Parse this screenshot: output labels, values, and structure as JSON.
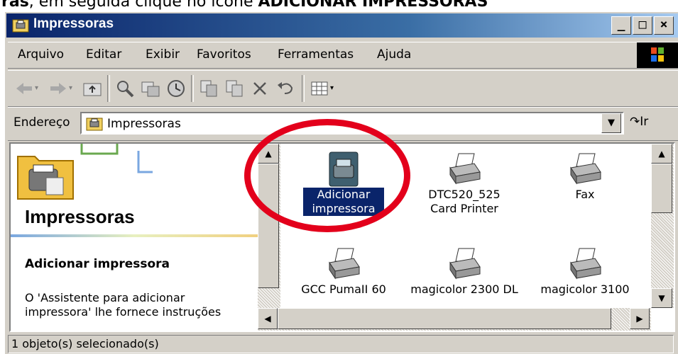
{
  "caption": {
    "prefix": "ras",
    "middle": ", em seguida clique no ícone ",
    "emphasis": "ADICIONAR IMPRESSORAS"
  },
  "window": {
    "title": "Impressoras",
    "controls": {
      "minimize": "_",
      "maximize": "□",
      "close": "×"
    }
  },
  "menubar": {
    "items": [
      {
        "label": "Arquivo"
      },
      {
        "label": "Editar"
      },
      {
        "label": "Exibir"
      },
      {
        "label": "Favoritos"
      },
      {
        "label": "Ferramentas"
      },
      {
        "label": "Ajuda"
      }
    ]
  },
  "toolbar": {
    "icons": [
      "back-icon",
      "forward-icon",
      "up-folder-icon",
      "search-icon",
      "folders-icon",
      "history-icon",
      "move-to-icon",
      "copy-to-icon",
      "delete-icon",
      "undo-icon",
      "views-icon"
    ]
  },
  "address": {
    "label": "Endereço",
    "value": "Impressoras",
    "go_label": "Ir"
  },
  "left_pane": {
    "title": "Impressoras",
    "subtitle": "Adicionar impressora",
    "description": "O 'Assistente para adicionar impressora' lhe fornece instruções"
  },
  "items": [
    {
      "label": "Adicionar impressora",
      "selected": true,
      "icon": "add-printer-icon"
    },
    {
      "label": "DTC520_525 Card Printer",
      "selected": false,
      "icon": "printer-icon"
    },
    {
      "label": "Fax",
      "selected": false,
      "icon": "fax-printer-icon"
    },
    {
      "label": "GCC PumaII 60",
      "selected": false,
      "icon": "printer-icon"
    },
    {
      "label": "magicolor 2300 DL",
      "selected": false,
      "icon": "printer-icon"
    },
    {
      "label": "magicolor 3100",
      "selected": false,
      "icon": "printer-icon"
    }
  ],
  "status": {
    "text": "1 objeto(s) selecionado(s)"
  },
  "colors": {
    "titlebar": "#0a246a",
    "selection": "#0a246a",
    "annotation": "#e3001b",
    "face": "#d4d0c8"
  }
}
